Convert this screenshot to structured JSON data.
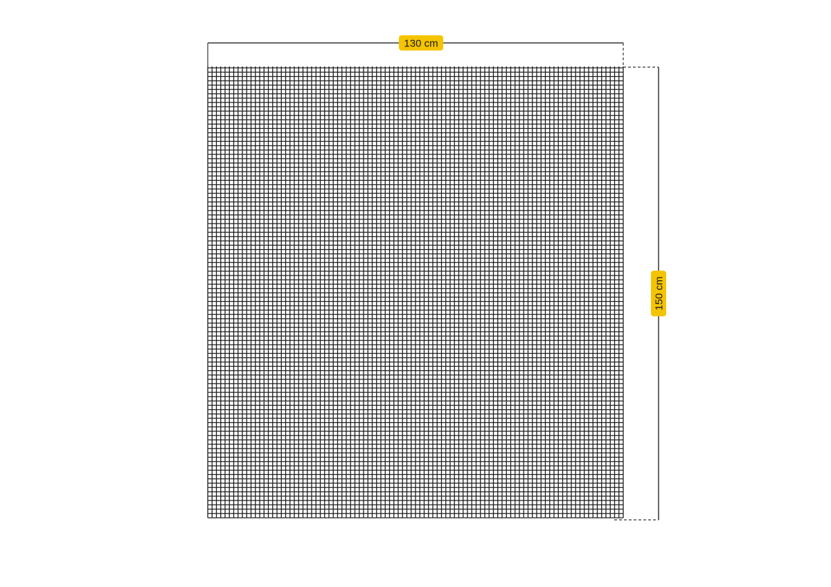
{
  "diagram": {
    "width_label": "130 cm",
    "height_label": "150 cm"
  },
  "colors": {
    "mesh": "#1b1b1b",
    "dimension_line": "#333333",
    "label_background": "#f5c400",
    "background": "#ffffff"
  }
}
